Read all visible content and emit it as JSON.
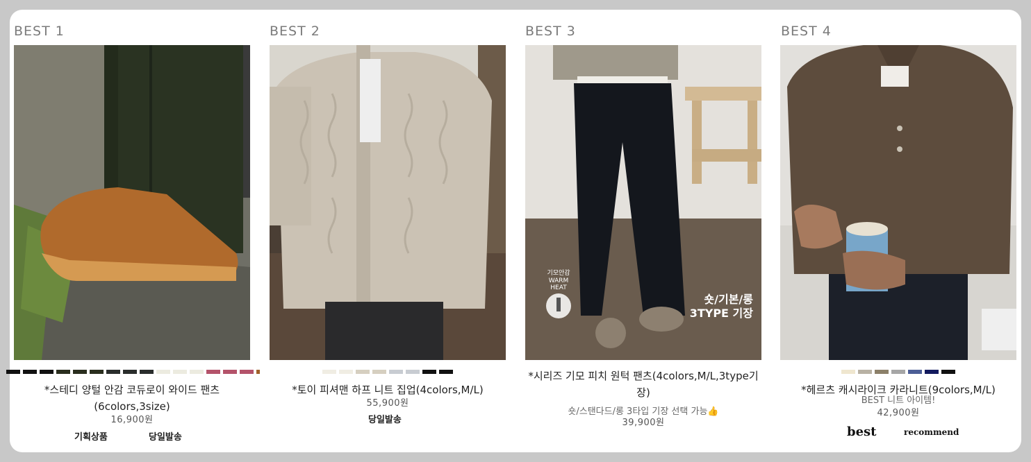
{
  "products": [
    {
      "rank_label": "BEST 1",
      "title": "*스테디 양털 안감 코듀로이 와이드 팬츠(6colors,3size)",
      "price": "16,900원",
      "tags": [
        "기획상품",
        "당일발송"
      ],
      "swatches": [
        "#111111",
        "#111111",
        "#111111",
        "#2a2e1e",
        "#2a2e1e",
        "#2a2e1e",
        "#2a2d2c",
        "#2a2d2c",
        "#2a2d2c",
        "#ecebe0",
        "#ecebe0",
        "#ecebe0",
        "#b4536a",
        "#b4536a",
        "#b4536a",
        "#a0612a"
      ]
    },
    {
      "rank_label": "BEST 2",
      "title": "*토이 피셔맨 하프 니트 집업(4colors,M/L)",
      "price": "55,900원",
      "tags": [
        "당일발송"
      ],
      "swatches": [
        "#f0ede3",
        "#f0ede3",
        "#d6cfc0",
        "#d6cfc0",
        "#c8ccd2",
        "#c8ccd2",
        "#111111",
        "#111111"
      ]
    },
    {
      "rank_label": "BEST 3",
      "title": "*시리즈 기모 피치 원턱 팬츠(4colors,M/L,3type기장)",
      "subtitle": "숏/스탠다드/롱 3타입 기장 선택 가능👍",
      "price": "39,900원",
      "overlay_text": "숏/기본/롱",
      "overlay_text2": "3TYPE 기장",
      "badge_text": "기모안감",
      "badge_text2": "WARM",
      "badge_text3": "HEAT",
      "swatches": []
    },
    {
      "rank_label": "BEST 4",
      "title": "*헤르츠 캐시라이크 카라니트(9colors,M/L)",
      "subtitle": "BEST 니트 아이템!",
      "price": "42,900원",
      "tags": [
        "best",
        "recommend"
      ],
      "swatches": [
        "#efe6cf",
        "#b8b1a4",
        "#8c8069",
        "#a6a6a6",
        "#4c5e96",
        "#131a5e",
        "#111111"
      ]
    }
  ]
}
